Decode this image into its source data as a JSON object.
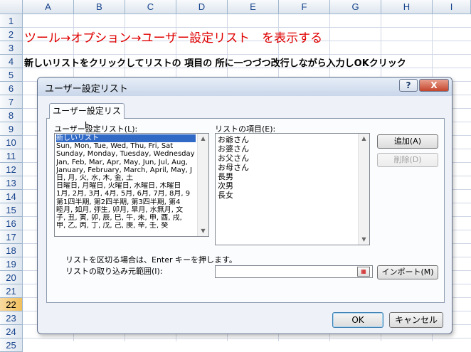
{
  "sheet": {
    "columns": [
      "A",
      "B",
      "C",
      "D",
      "E",
      "F",
      "G",
      "H",
      "I"
    ],
    "rows": [
      "1",
      "2",
      "3",
      "4",
      "5",
      "6",
      "7",
      "8",
      "9",
      "10",
      "11",
      "12",
      "13",
      "14",
      "15",
      "16",
      "17",
      "18",
      "19",
      "20",
      "21",
      "22",
      "23",
      "24",
      "25"
    ],
    "active_row": "22",
    "cell_a2": "ツール→オプション→ユーザー設定リスト　を表示する",
    "cell_a4": "新しいリストをクリックしてリストの 項目の 所に一つづつ改行しながら入力しOKクリック",
    "colors": {
      "a2_text": "#e00000",
      "grid_line": "#d0d7e5",
      "header_text": "#15428b"
    }
  },
  "dialog": {
    "title": "ユーザー設定リスト",
    "help_label": "?",
    "close_label": "X",
    "tab_label": "ユーザー設定リスト",
    "lists_label": "ユーザー設定リスト(L):",
    "entries_label": "リストの項目(E):",
    "lists": [
      "新しいリスト",
      "Sun, Mon, Tue, Wed, Thu, Fri, Sat",
      "Sunday, Monday, Tuesday, Wednesday",
      "Jan, Feb, Mar, Apr, May, Jun, Jul, Aug,",
      "January, February, March, April, May, J",
      "日, 月, 火, 水, 木, 金, 土",
      "日曜日, 月曜日, 火曜日, 水曜日, 木曜日",
      "1月, 2月, 3月, 4月, 5月, 6月, 7月, 8月, 9",
      "第1四半期, 第2四半期, 第3四半期, 第4",
      "睦月, 如月, 弥生, 卯月, 皐月, 水無月, 文",
      "子, 丑, 寅, 卯, 辰, 巳, 午, 未, 申, 酉, 戌,",
      "甲, 乙, 丙, 丁, 戊, 己, 庚, 辛, 壬, 癸"
    ],
    "selected_list_index": 0,
    "entries": [
      "お爺さん",
      "お婆さん",
      "お父さん",
      "お母さん",
      "長男",
      "次男",
      "長女"
    ],
    "add_label": "追加(A)",
    "delete_label": "削除(D)",
    "hint": "リストを区切る場合は、Enter キーを押します。",
    "range_label": "リストの取り込み元範囲(I):",
    "range_value": "",
    "import_label": "インポート(M)",
    "ok_label": "OK",
    "cancel_label": "キャンセル",
    "colors": {
      "selection": "#3169c6",
      "close_button": "#c5452c"
    }
  }
}
